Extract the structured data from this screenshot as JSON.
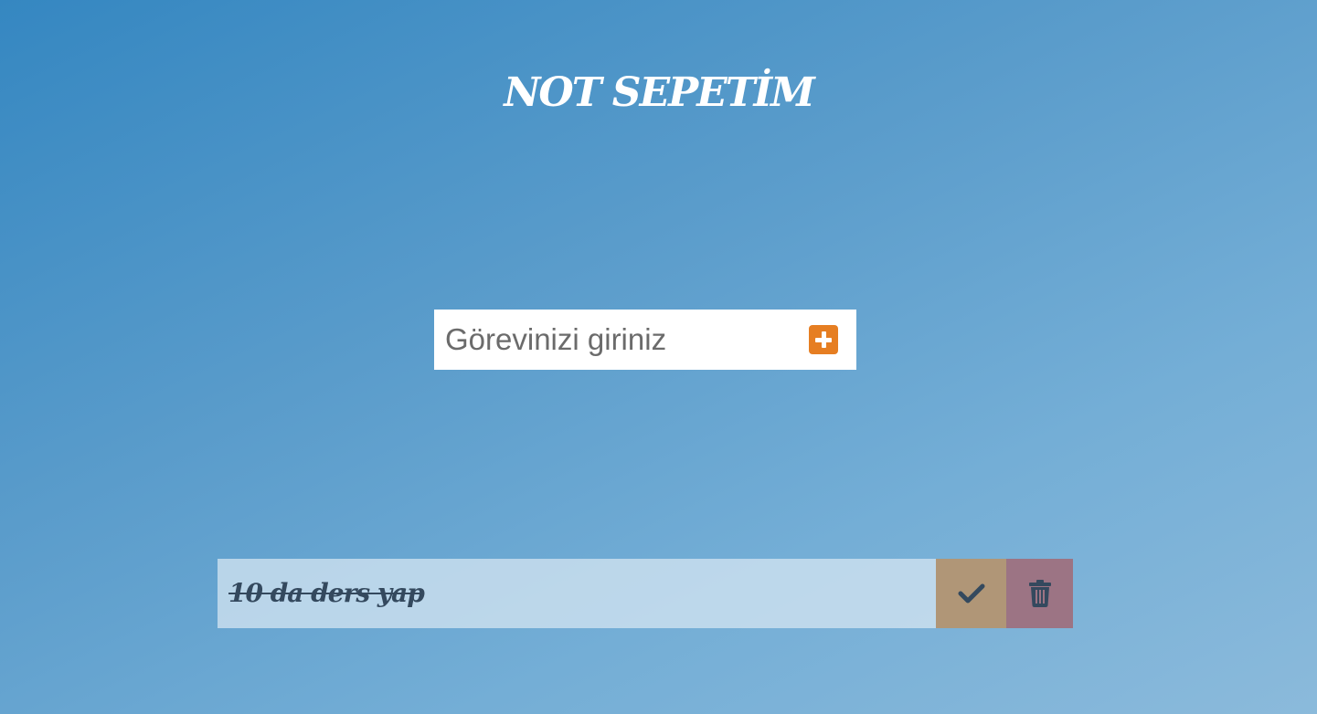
{
  "app": {
    "title": "NOT SEPETİM"
  },
  "form": {
    "placeholder": "Görevinizi giriniz",
    "value": "",
    "add_icon": "plus-square-icon",
    "add_color": "#e67e22"
  },
  "todos": [
    {
      "text": "10 da ders yap",
      "completed": true,
      "complete_icon": "check-icon",
      "delete_icon": "trash-icon"
    }
  ],
  "colors": {
    "background_start": "#3587c1",
    "background_end": "#8bbadb",
    "text_dark": "#34495e",
    "complete_button": "#b09677",
    "delete_button": "#9c7484"
  }
}
